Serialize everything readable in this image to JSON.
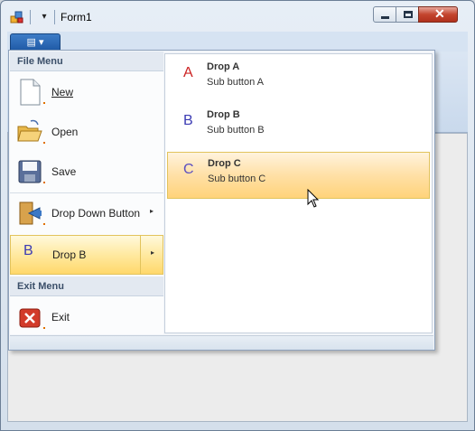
{
  "window": {
    "title": "Form1",
    "qat_dropdown_glyph": "▾"
  },
  "app_button": {
    "glyph": "▤ ▾"
  },
  "menu": {
    "file_header": "File Menu",
    "items": [
      {
        "label": "New",
        "icon": "new-document-icon"
      },
      {
        "label": "Open",
        "icon": "open-folder-icon"
      },
      {
        "label": "Save",
        "icon": "save-disk-icon"
      },
      {
        "label": "Drop Down Button",
        "icon": "exit-door-icon",
        "has_arrow": true
      },
      {
        "label": "Drop B",
        "letter": "B",
        "selected": true,
        "has_arrow": true
      }
    ],
    "exit_header": "Exit Menu",
    "exit_item": {
      "label": "Exit",
      "icon": "close-icon"
    },
    "arrow_glyph": "▸"
  },
  "submenu": {
    "items": [
      {
        "letter": "A",
        "title": "Drop A",
        "desc": "Sub button A",
        "letter_color": "#cc2222"
      },
      {
        "letter": "B",
        "title": "Drop B",
        "desc": "Sub button B",
        "letter_color": "#3b3bb3"
      },
      {
        "letter": "C",
        "title": "Drop C",
        "desc": "Sub button C",
        "letter_color": "#5b4fc0",
        "selected": true
      }
    ]
  },
  "colors": {
    "highlight": "#ffd86b",
    "accent": "#1f5aa6",
    "close": "#c4452e"
  }
}
